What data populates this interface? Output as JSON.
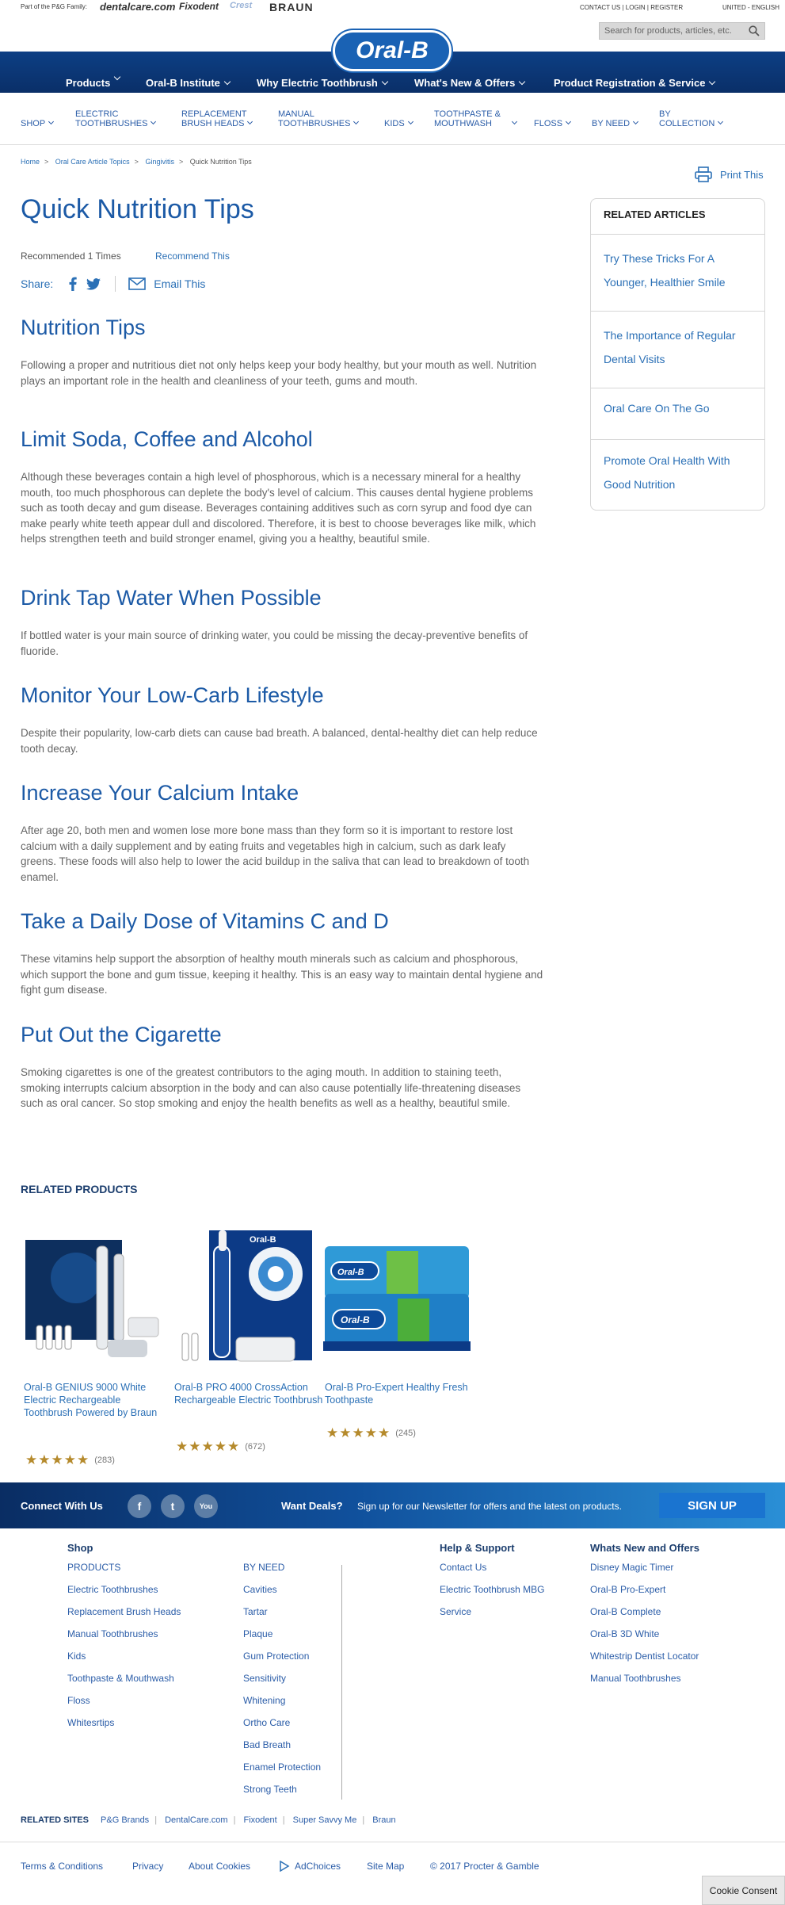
{
  "topbar": {
    "pg_family": "Part of the P&G Family:",
    "brands": [
      "dentalcare.com",
      "Fixodent",
      "Crest",
      "BRAUN"
    ],
    "contact": "CONTACT US",
    "login": "LOGIN",
    "register": "REGISTER",
    "region": "UNITED - ENGLISH",
    "search_placeholder": "Search for products, articles, etc."
  },
  "logo": "Oral-B",
  "mainnav": [
    "Products",
    "Oral-B Institute",
    "Why Electric Toothbrush",
    "What's New & Offers",
    "Product Registration & Service"
  ],
  "catnav": [
    [
      "SHOP"
    ],
    [
      "ELECTRIC",
      "TOOTHBRUSHES"
    ],
    [
      "REPLACEMENT",
      "BRUSH HEADS"
    ],
    [
      "MANUAL",
      "TOOTHBRUSHES"
    ],
    [
      "KIDS"
    ],
    [
      "TOOTHPASTE &",
      "MOUTHWASH"
    ],
    [
      "FLOSS"
    ],
    [
      "BY NEED"
    ],
    [
      "BY",
      "COLLECTION"
    ]
  ],
  "breadcrumb": [
    "Home",
    "Oral Care Article Topics",
    "Gingivitis",
    "Quick Nutrition Tips"
  ],
  "print_label": "Print This",
  "article": {
    "title": "Quick Nutrition Tips",
    "recommended": "Recommended 1 Times",
    "recommend_link": "Recommend This",
    "share_label": "Share:",
    "email_label": "Email This",
    "sections": [
      {
        "heading": "Nutrition Tips",
        "body": "Following a proper and nutritious diet not only helps keep your body healthy, but your mouth as well. Nutrition plays an important role in the health and cleanliness of your teeth, gums and mouth."
      },
      {
        "heading": "Limit Soda, Coffee and Alcohol",
        "body": "Although these beverages contain a high level of phosphorous, which is a necessary mineral for a healthy mouth, too much phosphorous can deplete the body's level of calcium. This causes dental hygiene problems such as tooth decay and gum disease. Beverages containing additives such as corn syrup and food dye can make pearly white teeth appear dull and discolored. Therefore, it is best to choose beverages like milk, which helps strengthen teeth and build stronger enamel, giving you a healthy, beautiful smile."
      },
      {
        "heading": "Drink Tap Water When Possible",
        "body": "If bottled water is your main source of drinking water, you could be missing the decay-preventive benefits of fluoride."
      },
      {
        "heading": "Monitor Your Low-Carb Lifestyle",
        "body": "Despite their popularity, low-carb diets can cause bad breath. A balanced, dental-healthy diet can help reduce tooth decay."
      },
      {
        "heading": "Increase Your Calcium Intake",
        "body": "After age 20, both men and women lose more bone mass than they form so it is important to restore lost calcium with a daily supplement and by eating fruits and vegetables high in calcium, such as dark leafy greens. These foods will also help to lower the acid buildup in the saliva that can lead to breakdown of tooth enamel."
      },
      {
        "heading": "Take a Daily Dose of Vitamins C and D",
        "body": "These vitamins help support the absorption of healthy mouth minerals such as calcium and phosphorous, which support the bone and gum tissue, keeping it healthy. This is an easy way to maintain dental hygiene and fight gum disease."
      },
      {
        "heading": "Put Out the Cigarette",
        "body": "Smoking cigarettes is one of the greatest contributors to the aging mouth. In addition to staining teeth, smoking interrupts calcium absorption in the body and can also cause potentially life-threatening diseases such as oral cancer. So stop smoking and enjoy the health benefits as well as a healthy, beautiful smile."
      }
    ]
  },
  "sidebar": {
    "title": "RELATED ARTICLES",
    "links": [
      "Try These Tricks For A Younger, Healthier Smile",
      "The Importance of Regular Dental Visits",
      "Oral Care On The Go",
      "Promote Oral Health With Good Nutrition"
    ]
  },
  "related_products": {
    "title": "RELATED PRODUCTS",
    "items": [
      {
        "name": "Oral-B GENIUS 9000 White Electric Rechargeable Toothbrush Powered by Braun",
        "rating": 5,
        "reviews": "(283)"
      },
      {
        "name": "Oral-B PRO 4000 CrossAction Rechargeable Electric Toothbrush",
        "rating": 5,
        "reviews": "(672)"
      },
      {
        "name": "Oral-B Pro-Expert Healthy Fresh Toothpaste",
        "rating": 5,
        "reviews": "(245)"
      }
    ]
  },
  "connect": {
    "label": "Connect With Us",
    "want_deals": "Want Deals?",
    "newsletter": "Sign up for our Newsletter for offers and the latest on products.",
    "signup": "SIGN UP"
  },
  "footer": {
    "shop_title": "Shop",
    "shop_col1": [
      "PRODUCTS",
      "Electric Toothbrushes",
      "Replacement Brush Heads",
      "Manual Toothbrushes",
      "Kids",
      "Toothpaste & Mouthwash",
      "Floss",
      "Whitesrtips"
    ],
    "shop_col2": [
      "BY NEED",
      "Cavities",
      "Tartar",
      "Plaque",
      "Gum Protection",
      "Sensitivity",
      "Whitening",
      "Ortho Care",
      "Bad Breath",
      "Enamel Protection",
      "Strong Teeth"
    ],
    "help_title": "Help & Support",
    "help_links": [
      "Contact Us",
      "Electric Toothbrush MBG",
      "Service"
    ],
    "whats_new_title": "Whats New and Offers",
    "whats_new_links": [
      "Disney Magic Timer",
      "Oral-B Pro-Expert",
      "Oral-B Complete",
      "Oral-B 3D White",
      "Whitestrip Dentist Locator",
      "Manual Toothbrushes"
    ],
    "related_sites_label": "RELATED SITES",
    "related_sites": [
      "P&G Brands",
      "DentalCare.com",
      "Fixodent",
      "Super Savvy Me",
      "Braun"
    ],
    "legal": [
      "Terms & Conditions",
      "Privacy",
      "About Cookies",
      "AdChoices",
      "Site Map",
      "© 2017 Procter & Gamble"
    ],
    "cookie_consent": "Cookie Consent"
  }
}
